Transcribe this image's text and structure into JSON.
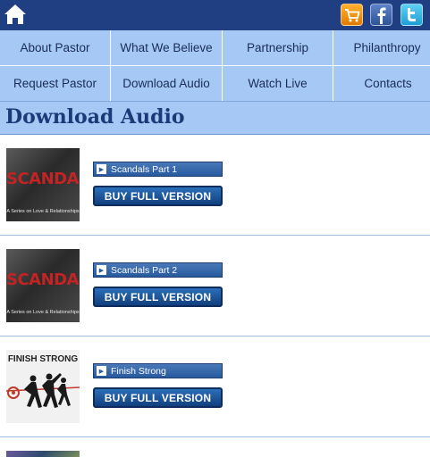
{
  "nav": {
    "row1": [
      "About Pastor",
      "What We Believe",
      "Partnership",
      "Philanthropy"
    ],
    "row2": [
      "Request Pastor",
      "Download Audio",
      "Watch Live",
      "Contacts"
    ]
  },
  "page": {
    "title": "Download Audio"
  },
  "items": [
    {
      "track": "Scandals Part 1",
      "buy_label": "BUY FULL VERSION",
      "thumb_title": "SCANDALS",
      "thumb_subtitle": "A Series on Love & Relationships"
    },
    {
      "track": "Scandals Part 2",
      "buy_label": "BUY FULL VERSION",
      "thumb_title": "SCANDALS",
      "thumb_subtitle": "A Series on Love & Relationships"
    },
    {
      "track": "Finish Strong",
      "buy_label": "BUY FULL VERSION",
      "thumb_title": "FINISH STRONG"
    }
  ],
  "colors": {
    "topbar": "#1f3f82",
    "nav_bg": "#a5c8f5",
    "title": "#1c3a78",
    "button": "#275a9e"
  },
  "icons": {
    "home": "home-icon",
    "cart": "cart-icon",
    "facebook": "facebook-icon",
    "twitter": "twitter-icon"
  }
}
